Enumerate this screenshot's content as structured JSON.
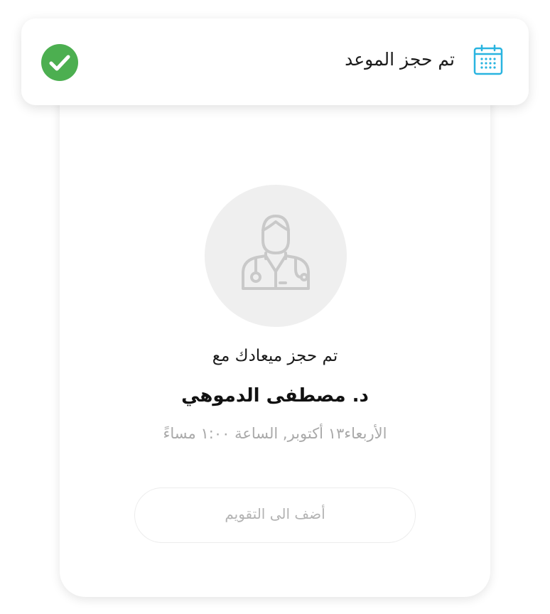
{
  "toast": {
    "title": "تم حجز الموعد",
    "calendar_icon": "calendar-icon",
    "status_icon": "check-circle-icon",
    "accent_color": "#29b4e0",
    "success_color": "#4caf50"
  },
  "booking": {
    "avatar_icon": "doctor-icon",
    "booked_with_text": "تم حجز ميعادك مع",
    "doctor_name": "د. مصطفى الدموهي",
    "datetime_text": "الأربعاء١٣ أكتوبر, الساعة ١:٠٠ مساءً",
    "add_to_calendar_label": "أضف الى التقويم"
  }
}
